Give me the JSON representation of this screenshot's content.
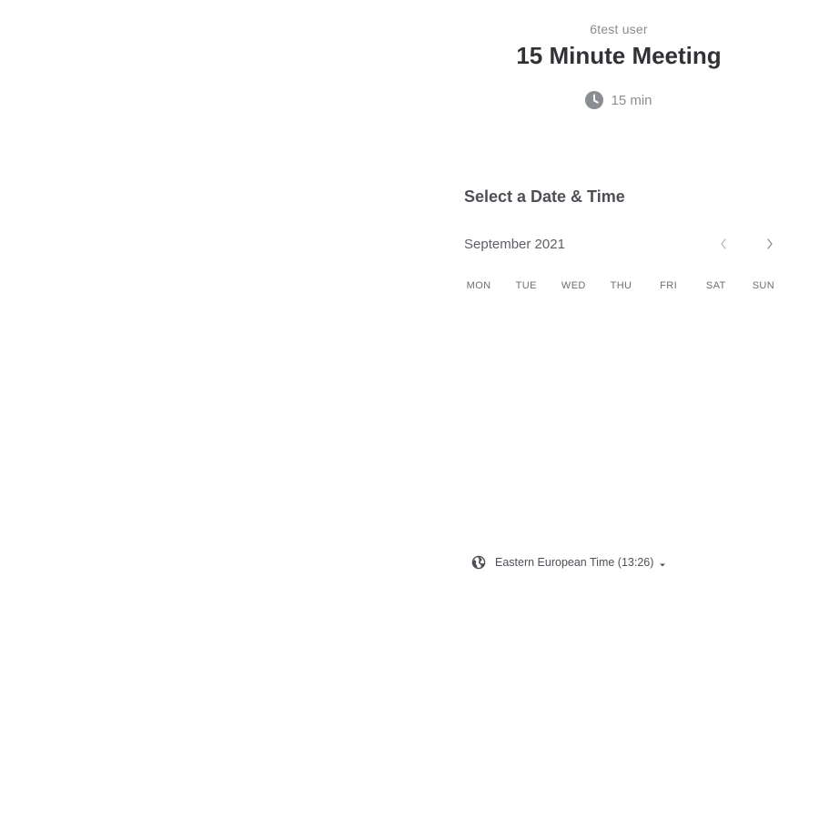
{
  "event": {
    "organizer": "6test user",
    "title": "15 Minute Meeting",
    "duration": "15 min",
    "duration_icon": "clock-icon"
  },
  "scheduler": {
    "section_title": "Select a Date & Time",
    "month_label": "September 2021",
    "prev_icon": "chevron-left-icon",
    "next_icon": "chevron-right-icon",
    "weekdays": [
      "MON",
      "TUE",
      "WED",
      "THU",
      "FRI",
      "SAT",
      "SUN"
    ]
  },
  "timezone": {
    "icon": "globe-icon",
    "label": "Eastern European Time (13:26)",
    "caret_icon": "caret-down-icon"
  },
  "colors": {
    "text_primary": "#303236",
    "text_secondary": "#8a8d92",
    "icon_gray": "#8a8d92",
    "chevron_gray": "#b5b7bb"
  }
}
